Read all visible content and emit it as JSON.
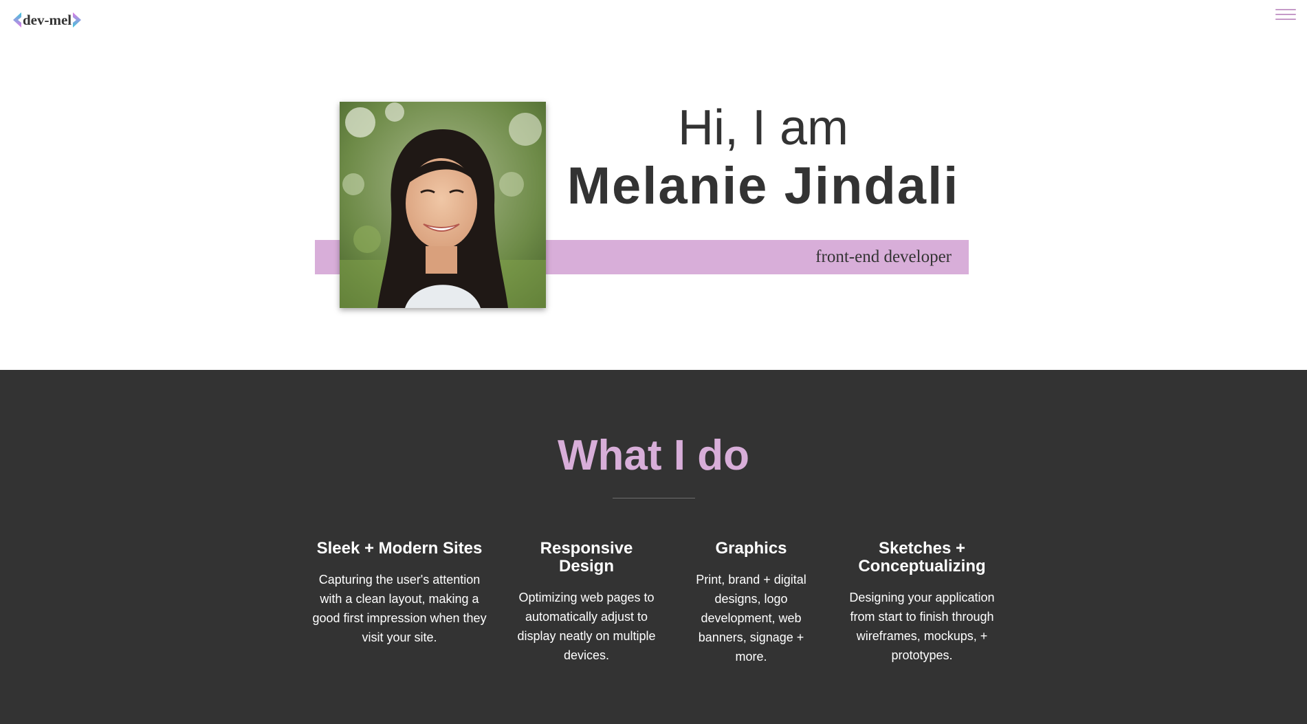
{
  "colors": {
    "accent": "#d8aed9",
    "accent_dark": "#c59ac8",
    "logo_teal": "#3cc5d9",
    "logo_pink": "#e17ae6",
    "text_dark": "#333333",
    "section_dark_bg": "#333333",
    "white": "#ffffff"
  },
  "nav": {
    "logo_text": "dev-mel",
    "logo_left_icon": "chevron-left-icon",
    "logo_right_icon": "chevron-right-icon",
    "menu_icon": "hamburger-menu-icon"
  },
  "hero": {
    "greeting": "Hi, I am",
    "name": "Melanie Jindali",
    "role": "front-end developer",
    "photo_icon": "profile-photo"
  },
  "services": {
    "title": "What I do",
    "items": [
      {
        "title": "Sleek + Modern Sites",
        "description": "Capturing the user's attention with a clean layout, making a good first impression when they visit your site."
      },
      {
        "title": "Responsive Design",
        "description": "Optimizing web pages to automatically adjust to display neatly on multiple devices."
      },
      {
        "title": "Graphics",
        "description": "Print, brand + digital designs, logo development, web banners, signage + more."
      },
      {
        "title": "Sketches + Conceptualizing",
        "description": "Designing your application from start to finish through wireframes, mockups, + prototypes."
      }
    ]
  }
}
